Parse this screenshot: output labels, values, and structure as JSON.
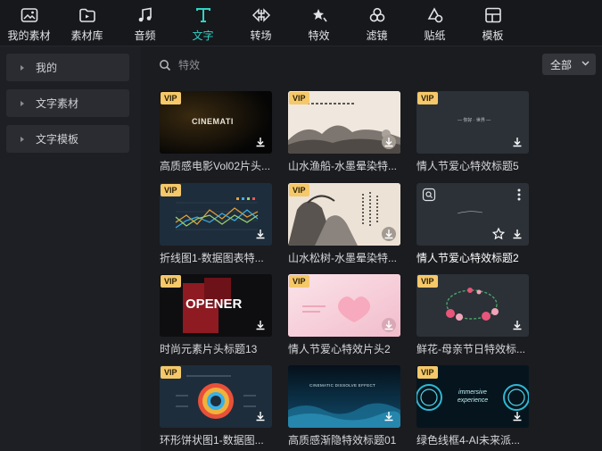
{
  "toolbar": {
    "items": [
      {
        "label": "我的素材",
        "icon": "my-media-icon"
      },
      {
        "label": "素材库",
        "icon": "library-icon"
      },
      {
        "label": "音频",
        "icon": "music-icon"
      },
      {
        "label": "文字",
        "icon": "text-icon"
      },
      {
        "label": "转场",
        "icon": "transition-icon"
      },
      {
        "label": "特效",
        "icon": "effects-icon"
      },
      {
        "label": "滤镜",
        "icon": "filter-icon"
      },
      {
        "label": "贴纸",
        "icon": "sticker-icon"
      },
      {
        "label": "模板",
        "icon": "template-icon"
      }
    ],
    "active_index": 3,
    "accent": "#2fd4c4"
  },
  "sidebar": {
    "items": [
      {
        "label": "我的"
      },
      {
        "label": "文字素材"
      },
      {
        "label": "文字模板"
      }
    ]
  },
  "search": {
    "placeholder": "特效",
    "value": ""
  },
  "filter": {
    "label": "全部"
  },
  "cards": [
    {
      "title": "高质感电影Vol02片头...",
      "vip": "VIP",
      "thumb_text": "CINEMATI"
    },
    {
      "title": "山水渔船-水墨晕染特...",
      "vip": "VIP",
      "thumb_text": ""
    },
    {
      "title": "情人节爱心特效标题5",
      "vip": "VIP",
      "thumb_text": "— 你好 · 世界 —"
    },
    {
      "title": "折线图1-数据图表特...",
      "vip": "VIP",
      "thumb_text": ""
    },
    {
      "title": "山水松树-水墨晕染特...",
      "vip": "VIP",
      "thumb_text": ""
    },
    {
      "title": "情人节爱心特效标题2",
      "vip": "",
      "thumb_text": ""
    },
    {
      "title": "时尚元素片头标题13",
      "vip": "VIP",
      "thumb_text": "OPENER"
    },
    {
      "title": "情人节爱心特效片头2",
      "vip": "VIP",
      "thumb_text": ""
    },
    {
      "title": "鲜花-母亲节日特效标...",
      "vip": "VIP",
      "thumb_text": ""
    },
    {
      "title": "环形饼状图1-数据图...",
      "vip": "VIP",
      "thumb_text": ""
    },
    {
      "title": "高质感渐隐特效标题01",
      "vip": "",
      "thumb_text": "CINEMATIC DISSOLVE EFFECT"
    },
    {
      "title": "绿色线框4-AI未来派...",
      "vip": "VIP",
      "thumb_text": "immersive experience"
    }
  ],
  "colors": {
    "vip_badge": "#f5c86a",
    "background": "#1b1c20",
    "sidebar": "#1e1f24"
  }
}
